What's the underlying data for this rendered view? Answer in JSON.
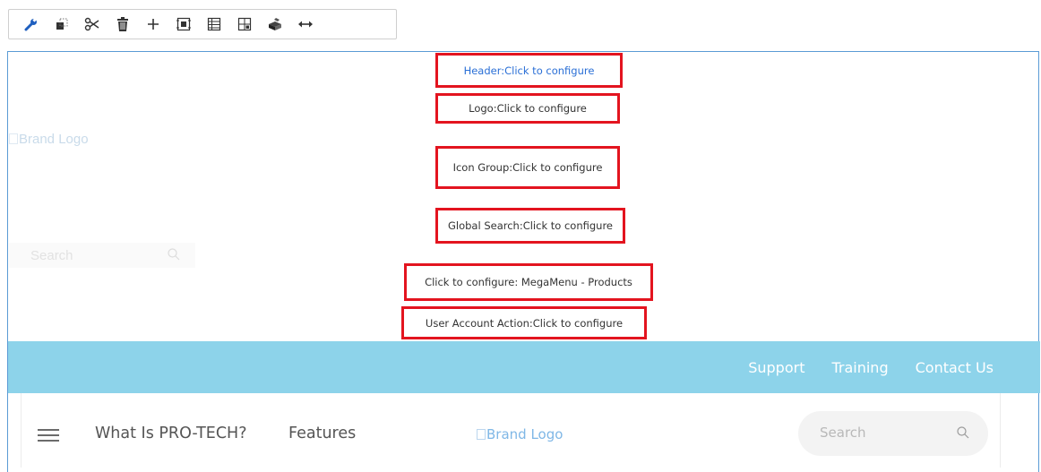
{
  "toolbar": {
    "tools": [
      {
        "icon": "wrench-icon"
      },
      {
        "icon": "copy-icon"
      },
      {
        "icon": "scissors-icon"
      },
      {
        "icon": "trash-icon"
      },
      {
        "icon": "plus-icon"
      },
      {
        "icon": "frame-icon"
      },
      {
        "icon": "table-icon"
      },
      {
        "icon": "grid-add-icon"
      },
      {
        "icon": "component-icon"
      },
      {
        "icon": "resize-horizontal-icon"
      }
    ]
  },
  "config_boxes": {
    "header": "Header:Click to configure",
    "logo": "Logo:Click to configure",
    "icon_group": "Icon Group:Click to configure",
    "global_search": "Global Search:Click to configure",
    "megamenu": "Click to configure: MegaMenu - Products",
    "user_account": "User Account Action:Click to configure"
  },
  "ghost": {
    "brand_logo_alt": "Brand Logo",
    "search_placeholder": "Search"
  },
  "utility_bar": {
    "color": "#8dd3ea",
    "links": [
      "Support",
      "Training",
      "Contact Us"
    ]
  },
  "main_nav": {
    "links": [
      "What Is PRO-TECH?",
      "Features"
    ],
    "brand_logo_alt": "Brand Logo",
    "search_placeholder": "Search"
  },
  "colors": {
    "frame_border": "#5b9bd5",
    "config_border": "#e3141f",
    "header_link": "#2a6fd6"
  }
}
